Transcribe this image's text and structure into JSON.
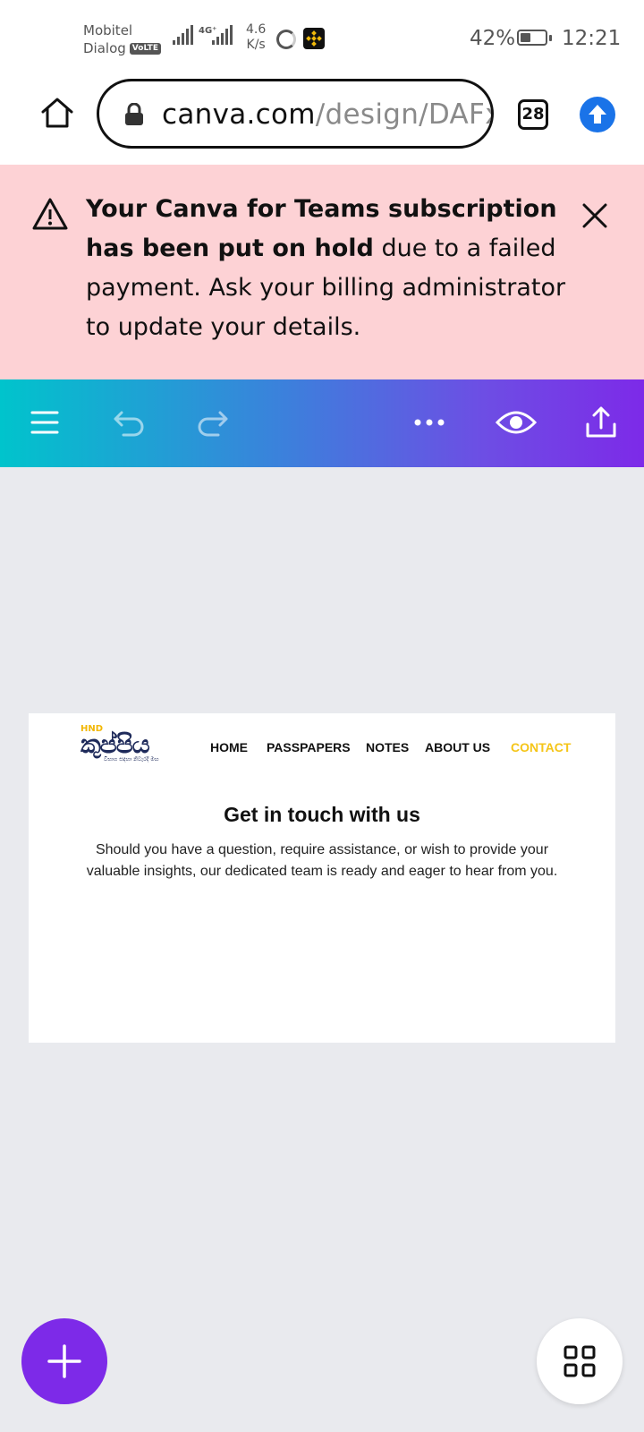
{
  "status_bar": {
    "carrier_line1": "Mobitel",
    "carrier_line2": "Dialog",
    "volte": "VoLTE",
    "network": "4G⁺",
    "speed_value": "4.6",
    "speed_unit": "K/s",
    "battery_percent": "42%",
    "battery_level": 0.42,
    "time": "12:21"
  },
  "browser": {
    "url_host": "canva.com",
    "url_path": "/design/DAFxl",
    "tab_count": "28"
  },
  "banner": {
    "bold_text": "Your Canva for Teams subscription has been put on hold",
    "rest_text": " due to a failed payment. Ask your billing administrator to update your details."
  },
  "design_page": {
    "logo_small": "HND",
    "logo_main": "කුප්පිය",
    "logo_tagline": "විභාග සඳහා නිවැරදි මඟ",
    "nav": [
      "HOME",
      "PASSPAPERS",
      "NOTES",
      "ABOUT US",
      "CONTACT"
    ],
    "title": "Get in touch with us",
    "body": "Should you have a question, require assistance, or wish to provide your valuable insights, our dedicated team is ready and eager to hear from you."
  },
  "colors": {
    "banner_bg": "#fdd2d5",
    "toolbar_gradient_start": "#00c4cc",
    "toolbar_gradient_end": "#7d2ae8",
    "fab_add": "#7d2ae8",
    "nav_active": "#f5c518",
    "upload_blue": "#1a73e8"
  },
  "icons": {
    "home": "home-icon",
    "lock": "lock-icon",
    "upload": "upload-arrow-icon",
    "warning": "warning-triangle-icon",
    "close": "close-icon",
    "menu": "hamburger-menu-icon",
    "undo": "undo-icon",
    "redo": "redo-icon",
    "more": "more-dots-icon",
    "preview": "eye-icon",
    "share": "share-icon",
    "add": "plus-icon",
    "pages": "grid-icon"
  }
}
